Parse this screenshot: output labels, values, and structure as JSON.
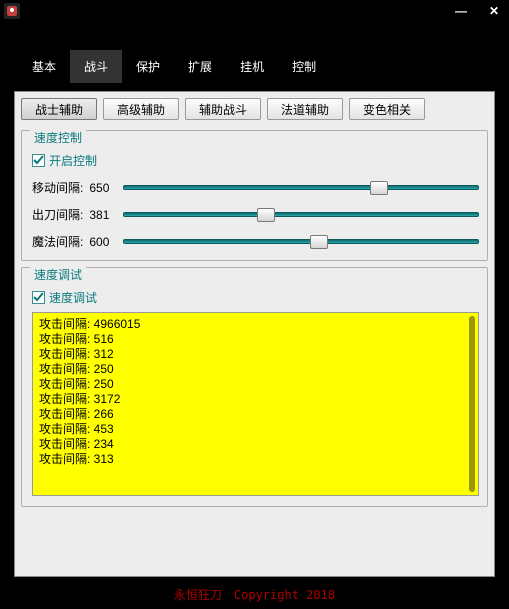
{
  "win": {
    "minimize": "—",
    "close": "✕"
  },
  "maintabs": [
    "基本",
    "战斗",
    "保护",
    "扩展",
    "挂机",
    "控制"
  ],
  "maintab_active": 1,
  "subtabs": [
    "战士辅助",
    "高级辅助",
    "辅助战斗",
    "法道辅助",
    "变色相关"
  ],
  "subtab_active": 0,
  "group_speed_ctrl": {
    "title": "速度控制",
    "checkbox": "开启控制",
    "checked": true,
    "sliders": [
      {
        "label": "移动间隔:",
        "value": "650",
        "pct": 72
      },
      {
        "label": "出刀间隔:",
        "value": "381",
        "pct": 40
      },
      {
        "label": "魔法间隔:",
        "value": "600",
        "pct": 55
      }
    ]
  },
  "group_speed_debug": {
    "title": "速度调试",
    "checkbox": "速度调试",
    "checked": true,
    "log": [
      "攻击间隔: 4966015",
      "攻击间隔: 516",
      "攻击间隔: 312",
      "攻击间隔: 250",
      "攻击间隔: 250",
      "攻击间隔: 3172",
      "攻击间隔: 266",
      "攻击间隔: 453",
      "攻击间隔: 234",
      "攻击间隔: 313"
    ]
  },
  "footer": "永恒狂刀　Copyright 2018"
}
